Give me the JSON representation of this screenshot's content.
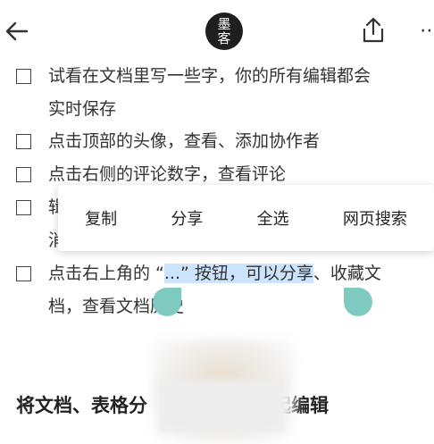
{
  "header": {
    "avatar_text_line1": "墨",
    "avatar_text_line2": "客",
    "more_label": "⋯"
  },
  "todos": [
    {
      "line1": "试看在文档里写一些字，你的所有编辑都会",
      "line2": "实时保存"
    },
    {
      "line1": "点击顶部的头像，查看、添加协作者"
    },
    {
      "line1": "点击右侧的评论数字，查看评论"
    },
    {
      "line1": "辑",
      "line2": "消"
    },
    {
      "line1_before": "点击右上角的 “",
      "line1_selected": "...” 按钮，可以分享",
      "line1_after": "、收藏文",
      "line2": "档，查看文档历史"
    }
  ],
  "context_menu": {
    "items": [
      "复制",
      "分享",
      "全选",
      "网页搜索"
    ]
  },
  "section": {
    "heading_left": "将文档、表格分",
    "heading_right": "起编辑"
  },
  "colors": {
    "selection": "#cde4ff",
    "handle": "#7ecac1",
    "text": "#333333"
  }
}
